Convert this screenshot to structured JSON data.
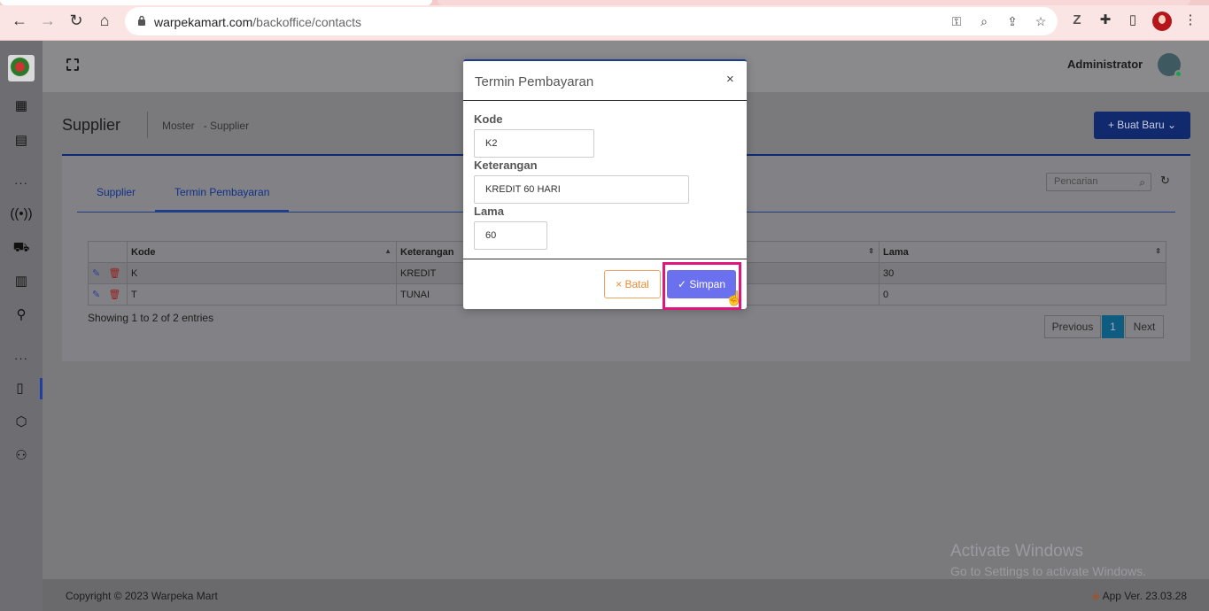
{
  "browser": {
    "url_host": "warpekamart.com",
    "url_path": "/backoffice/contacts"
  },
  "header": {
    "user_name": "Administrator"
  },
  "page": {
    "title": "Supplier",
    "breadcrumb": [
      "Moster",
      "- Supplier"
    ],
    "new_button": "+ Buat Baru"
  },
  "tabs": [
    {
      "label": "Supplier",
      "active": false
    },
    {
      "label": "Termin Pembayaran",
      "active": true
    }
  ],
  "search": {
    "placeholder": "Pencarian"
  },
  "table": {
    "columns": [
      "Kode",
      "Keterangan",
      "Lama"
    ],
    "rows": [
      {
        "kode": "K",
        "keterangan": "KREDIT",
        "lama": "30"
      },
      {
        "kode": "T",
        "keterangan": "TUNAI",
        "lama": "0"
      }
    ],
    "info": "Showing 1 to 2 of 2 entries",
    "pager": {
      "previous": "Previous",
      "current": "1",
      "next": "Next"
    }
  },
  "modal": {
    "title": "Termin Pembayaran",
    "close": "×",
    "fields": {
      "kode_label": "Kode",
      "kode_value": "K2",
      "keterangan_label": "Keterangan",
      "keterangan_value": "KREDIT 60 HARI",
      "lama_label": "Lama",
      "lama_value": "60"
    },
    "cancel_label": "× Batal",
    "save_label": "✓ Simpan"
  },
  "footer": {
    "copyright": "Copyright © 2023 Warpeka Mart",
    "version": "App Ver. 23.03.28"
  },
  "watermark": {
    "line1": "Activate Windows",
    "line2": "Go to Settings to activate Windows."
  },
  "colors": {
    "accent": "#112a6e",
    "save_button": "#6b70ee",
    "cancel_border": "#f0a25e",
    "highlight": "#e0177a"
  }
}
